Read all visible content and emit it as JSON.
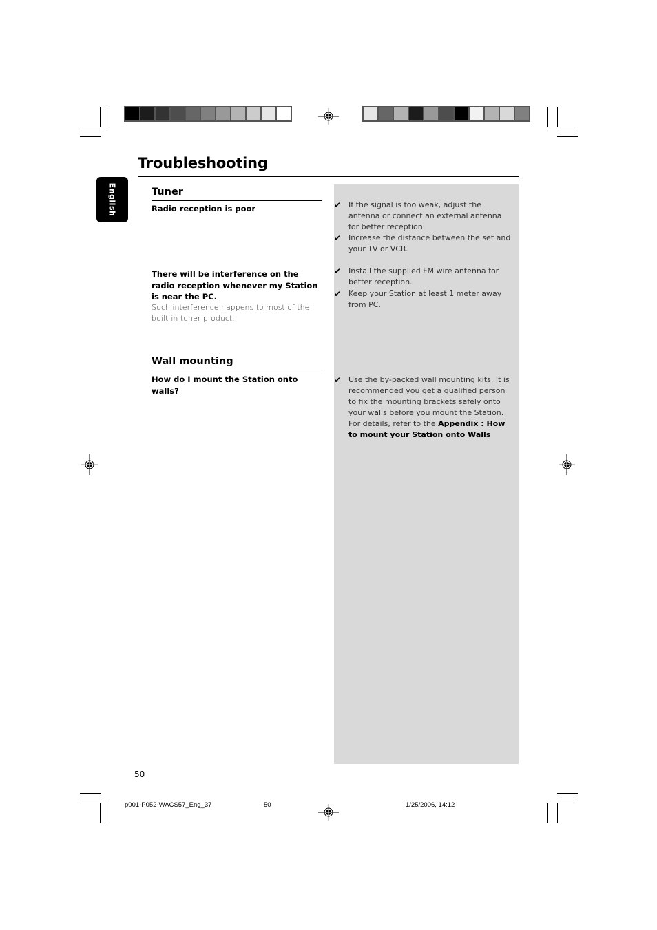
{
  "page": {
    "title": "Troubleshooting",
    "language_tab": "English",
    "page_number": "50"
  },
  "sections": [
    {
      "heading": "Tuner",
      "problems": [
        {
          "question": "Radio reception is poor",
          "description": "",
          "solutions": [
            "If the signal is too weak, adjust the antenna or connect an external antenna for better reception.",
            "Increase the distance between the set and your TV or VCR."
          ]
        },
        {
          "question": "There will be interference on the radio reception whenever my Station is near the PC.",
          "description": "Such interference happens to most of the built-in tuner product.",
          "solutions": [
            "Install the supplied FM wire antenna for better reception.",
            "Keep your Station at least 1 meter away from PC."
          ]
        }
      ]
    },
    {
      "heading": "Wall mounting",
      "problems": [
        {
          "question": "How do I  mount the Station onto walls?",
          "description": "",
          "solution_text": "Use the by-packed wall mounting kits.  It is recommended you get a qualified person to fix the mounting brackets safely onto your walls before you mount the Station. For details, refer to the ",
          "solution_bold": "Appendix : How to mount your Station onto Walls"
        }
      ]
    }
  ],
  "icons": {
    "check": "✔"
  },
  "footer": {
    "filename": "p001-P052-WACS57_Eng_37",
    "page": "50",
    "timestamp": "1/25/2006, 14:12"
  },
  "print_marks": {
    "colorbar_left": [
      "#000000",
      "#1c1c1c",
      "#333333",
      "#4d4d4d",
      "#666666",
      "#808080",
      "#999999",
      "#b3b3b3",
      "#cccccc",
      "#e6e6e6",
      "#ffffff"
    ],
    "colorbar_right": [
      "#e6e6e6",
      "#666666",
      "#b3b3b3",
      "#1c1c1c",
      "#999999",
      "#4d4d4d",
      "#000000",
      "#f2f2f2",
      "#b3b3b3",
      "#d9d9d9",
      "#808080"
    ]
  }
}
